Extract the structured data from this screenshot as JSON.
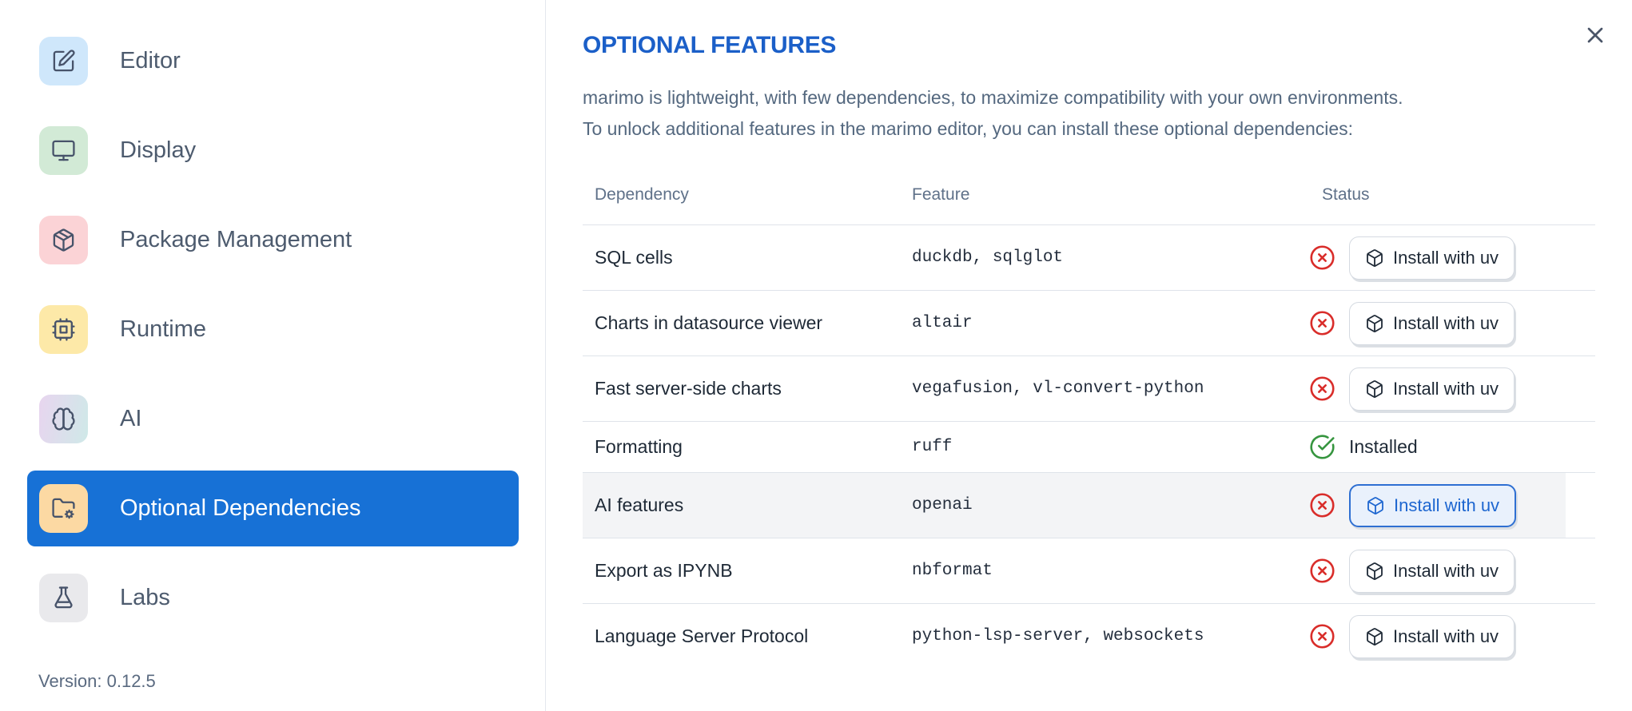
{
  "colors": {
    "accent_blue": "#1771d6",
    "title_blue": "#1b5fc8",
    "error_red": "#d92d2a",
    "success_green": "#36953f",
    "editor_tile_bg": "#cfe7fb",
    "display_tile_bg": "#d2ead6",
    "package_tile_bg": "#fbd3d6",
    "runtime_tile_bg": "#fde9a8",
    "ai_tile_bg": "linear-gradient(100deg, #e8d5ef 0%, #cfe9e8 100%)",
    "optional_deps_tile_bg": "#fcd9a3",
    "labs_tile_bg": "#e9e9ec"
  },
  "sidebar": {
    "items": [
      {
        "label": "Editor",
        "icon": "edit-icon",
        "bg": "#cfe7fb",
        "selected": false
      },
      {
        "label": "Display",
        "icon": "monitor-icon",
        "bg": "#d2ead6",
        "selected": false
      },
      {
        "label": "Package Management",
        "icon": "package-icon",
        "bg": "#fbd3d6",
        "selected": false
      },
      {
        "label": "Runtime",
        "icon": "cpu-icon",
        "bg": "#fde9a8",
        "selected": false
      },
      {
        "label": "AI",
        "icon": "brain-icon",
        "bg": "linear-gradient(100deg, #e8d5ef 0%, #cfe9e8 100%)",
        "selected": false
      },
      {
        "label": "Optional Dependencies",
        "icon": "folder-cog-icon",
        "bg": "#fcd9a3",
        "selected": true
      },
      {
        "label": "Labs",
        "icon": "flask-icon",
        "bg": "#e9e9ec",
        "selected": false
      }
    ],
    "version": "Version: 0.12.5"
  },
  "panel": {
    "title": "OPTIONAL FEATURES",
    "description_line1": "marimo is lightweight, with few dependencies, to maximize compatibility with your own environments.",
    "description_line2": "To unlock additional features in the marimo editor, you can install these optional dependencies:"
  },
  "table": {
    "headers": [
      "Dependency",
      "Feature",
      "Status"
    ],
    "install_button_label": "Install with uv",
    "installed_label": "Installed",
    "rows": [
      {
        "dependency": "SQL cells",
        "feature": "duckdb, sqlglot",
        "status": "missing"
      },
      {
        "dependency": "Charts in datasource viewer",
        "feature": "altair",
        "status": "missing"
      },
      {
        "dependency": "Fast server-side charts",
        "feature": "vegafusion, vl-convert-python",
        "status": "missing"
      },
      {
        "dependency": "Formatting",
        "feature": "ruff",
        "status": "installed"
      },
      {
        "dependency": "AI features",
        "feature": "openai",
        "status": "missing",
        "highlighted": true
      },
      {
        "dependency": "Export as IPYNB",
        "feature": "nbformat",
        "status": "missing"
      },
      {
        "dependency": "Language Server Protocol",
        "feature": "python-lsp-server, websockets",
        "status": "missing"
      }
    ]
  }
}
